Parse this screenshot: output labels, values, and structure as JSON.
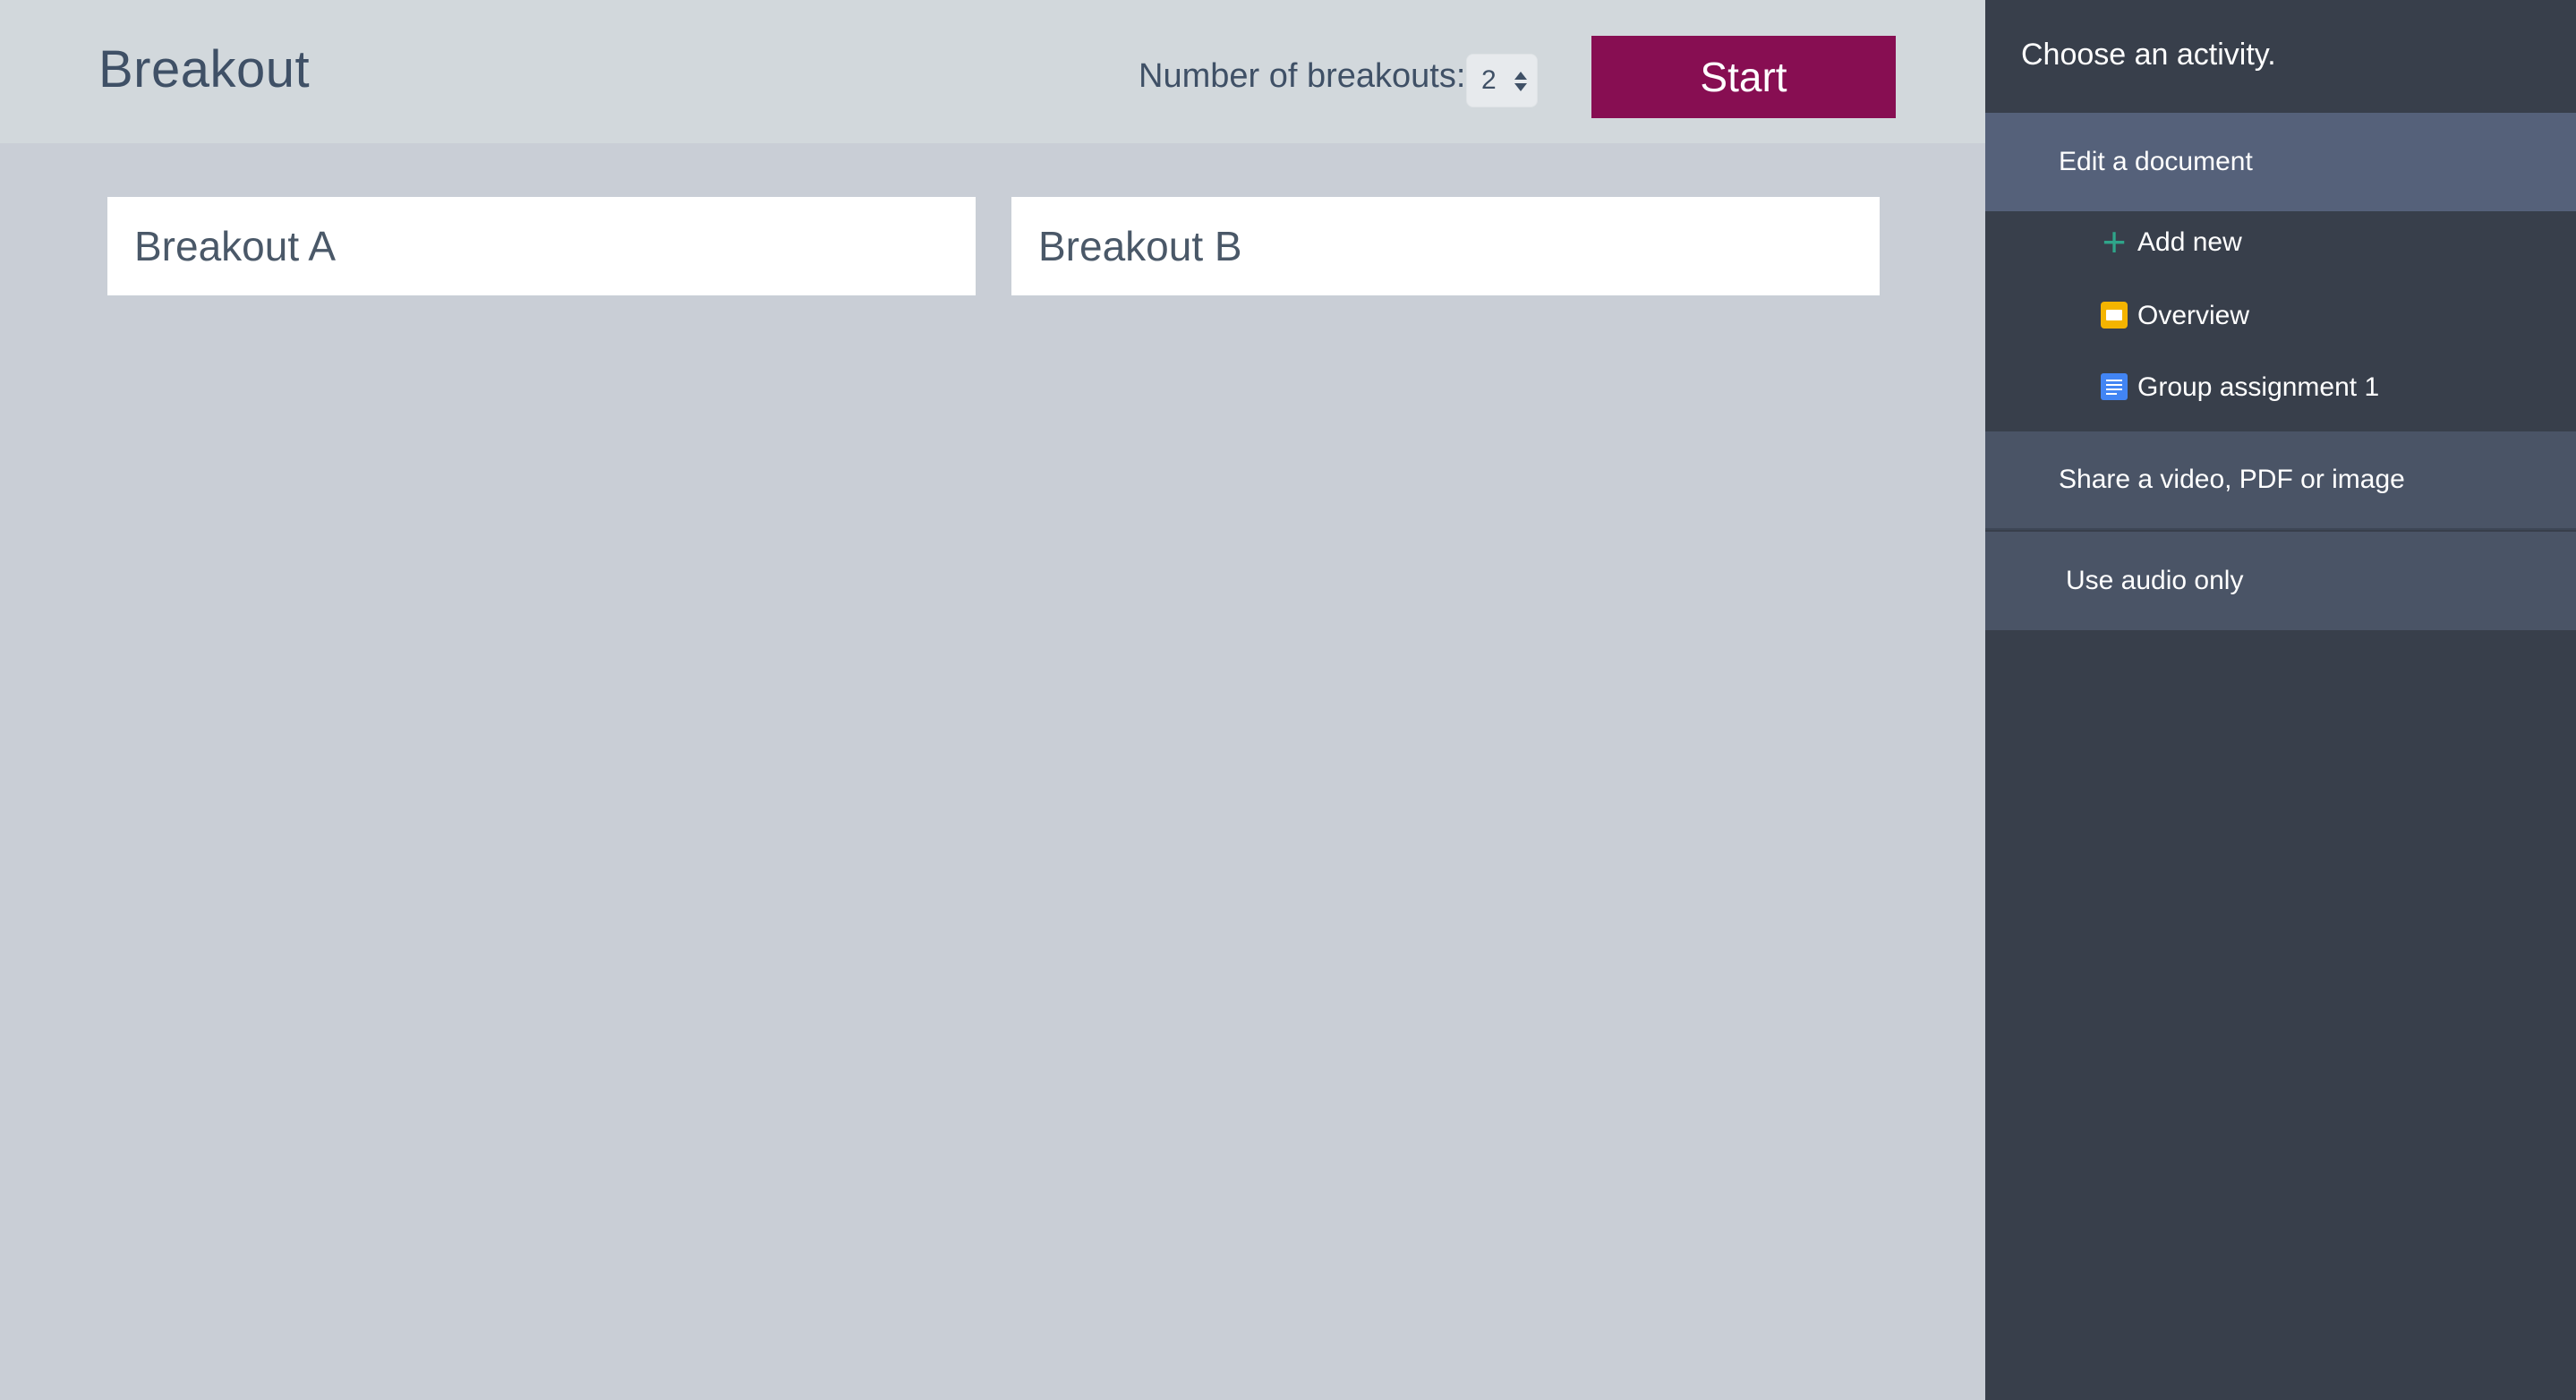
{
  "header": {
    "title": "Breakout",
    "count_label": "Number of breakouts:",
    "count_value": "2",
    "start_label": "Start"
  },
  "breakouts": [
    {
      "name": "Breakout A"
    },
    {
      "name": "Breakout B"
    }
  ],
  "sidebar": {
    "heading": "Choose an activity.",
    "sections": [
      {
        "label": "Edit a document",
        "items": [
          {
            "label": "Add new",
            "icon": "plus-icon"
          },
          {
            "label": "Overview",
            "icon": "slides-icon"
          },
          {
            "label": "Group assignment 1",
            "icon": "docs-icon"
          }
        ]
      },
      {
        "label": "Share a video, PDF or image"
      },
      {
        "label": "Use audio only"
      }
    ]
  },
  "colors": {
    "accent": "#870e52",
    "sidebar_bg": "#383f4b",
    "active_section_bg": "#55617a",
    "main_bg": "#c9ced6",
    "header_bg": "#d2d8dc"
  }
}
